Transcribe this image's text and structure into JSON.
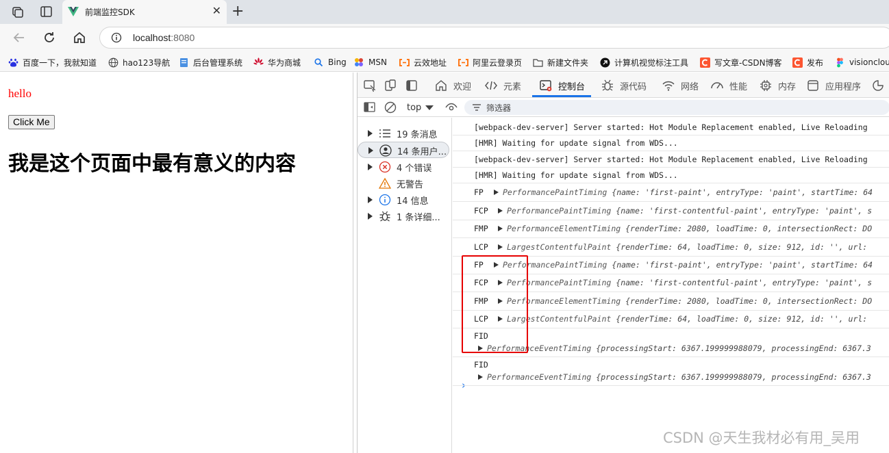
{
  "tab": {
    "title": "前端监控SDK",
    "close": "✕",
    "new_tab": "+"
  },
  "address": {
    "host": "localhost",
    "port": ":8080"
  },
  "bookmarks": [
    {
      "label": "百度一下，我就知道",
      "icon": "baidu-icon",
      "color": "#2932e1"
    },
    {
      "label": "hao123导航",
      "icon": "globe-icon",
      "color": "#555555"
    },
    {
      "label": "后台管理系统",
      "icon": "page-icon",
      "color": "#4a90e2"
    },
    {
      "label": "华为商城",
      "icon": "huawei-icon",
      "color": "#cf0a2c"
    },
    {
      "label": "Bing",
      "icon": "search-icon",
      "color": "#1a73e8"
    },
    {
      "label": "MSN",
      "icon": "msn-icon",
      "color": "#7b61ff"
    },
    {
      "label": "云效地址",
      "icon": "aliyun-icon",
      "color": "#ff6a00"
    },
    {
      "label": "阿里云登录页",
      "icon": "aliyun-icon",
      "color": "#ff6a00"
    },
    {
      "label": "新建文件夹",
      "icon": "folder-icon",
      "color": "#444444"
    },
    {
      "label": "计算机视觉标注工具",
      "icon": "arrow-circle-icon",
      "color": "#111111"
    },
    {
      "label": "写文章-CSDN博客",
      "icon": "csdn-icon",
      "color": "#fc5531"
    },
    {
      "label": "发布",
      "icon": "csdn-icon",
      "color": "#fc5531"
    },
    {
      "label": "visioncloud",
      "icon": "figma-icon",
      "color": "#f24e1e"
    }
  ],
  "page": {
    "hello": "hello",
    "button": "Click Me",
    "heading": "我是这个页面中最有意义的内容"
  },
  "devtools": {
    "tabs": [
      {
        "label": "欢迎",
        "icon": "home-icon"
      },
      {
        "label": "元素",
        "icon": "code-icon"
      },
      {
        "label": "控制台",
        "icon": "console-icon"
      },
      {
        "label": "源代码",
        "icon": "bug-icon"
      },
      {
        "label": "网络",
        "icon": "wifi-icon"
      },
      {
        "label": "性能",
        "icon": "gauge-icon"
      },
      {
        "label": "内存",
        "icon": "chip-icon"
      },
      {
        "label": "应用程序",
        "icon": "app-icon"
      }
    ],
    "context": "top",
    "filter_label": "筛选器",
    "sidebar": [
      {
        "label": "19 条消息",
        "icon": "list-icon"
      },
      {
        "label": "14 条用户...",
        "icon": "user-icon"
      },
      {
        "label": "4 个错误",
        "icon": "error-icon"
      },
      {
        "label": "无警告",
        "icon": "warning-icon"
      },
      {
        "label": "14 信息",
        "icon": "info-icon"
      },
      {
        "label": "1 条详细...",
        "icon": "bug-icon"
      }
    ],
    "console": {
      "plain": [
        "[webpack-dev-server] Server started: Hot Module Replacement enabled, Live Reloading",
        "[HMR] Waiting for update signal from WDS...",
        "[webpack-dev-server] Server started: Hot Module Replacement enabled, Live Reloading",
        "[HMR] Waiting for update signal from WDS..."
      ],
      "entries": [
        {
          "label": "FP",
          "cls": "PerformancePaintTiming",
          "body": "{name: 'first-paint', entryType: 'paint', startTime: 64"
        },
        {
          "label": "FCP",
          "cls": "PerformancePaintTiming",
          "body": "{name: 'first-contentful-paint', entryType: 'paint', s"
        },
        {
          "label": "FMP",
          "cls": "PerformanceElementTiming",
          "body": "{renderTime: 2080, loadTime: 0, intersectionRect: DO"
        },
        {
          "label": "LCP",
          "cls": "LargestContentfulPaint",
          "body": "{renderTime: 64, loadTime: 0, size: 912, id: '', url: "
        },
        {
          "label": "FP",
          "cls": "PerformancePaintTiming",
          "body": "{name: 'first-paint', entryType: 'paint', startTime: 64"
        },
        {
          "label": "FCP",
          "cls": "PerformancePaintTiming",
          "body": "{name: 'first-contentful-paint', entryType: 'paint', s"
        },
        {
          "label": "FMP",
          "cls": "PerformanceElementTiming",
          "body": "{renderTime: 2080, loadTime: 0, intersectionRect: DO"
        },
        {
          "label": "LCP",
          "cls": "LargestContentfulPaint",
          "body": "{renderTime: 64, loadTime: 0, size: 912, id: '', url: "
        }
      ],
      "fid": [
        {
          "label": "FID",
          "cls": "PerformanceEventTiming",
          "body": "{processingStart: 6367.199999988079, processingEnd: 6367.3"
        },
        {
          "label": "FID",
          "cls": "PerformanceEventTiming",
          "body": "{processingStart: 6367.199999988079, processingEnd: 6367.3"
        }
      ],
      "prompt": "›"
    }
  },
  "watermark": "CSDN @天生我材必有用_吴用",
  "colors": {
    "accent": "#1a73e8",
    "highlight": "#e60000",
    "hello": "#ff0000"
  }
}
